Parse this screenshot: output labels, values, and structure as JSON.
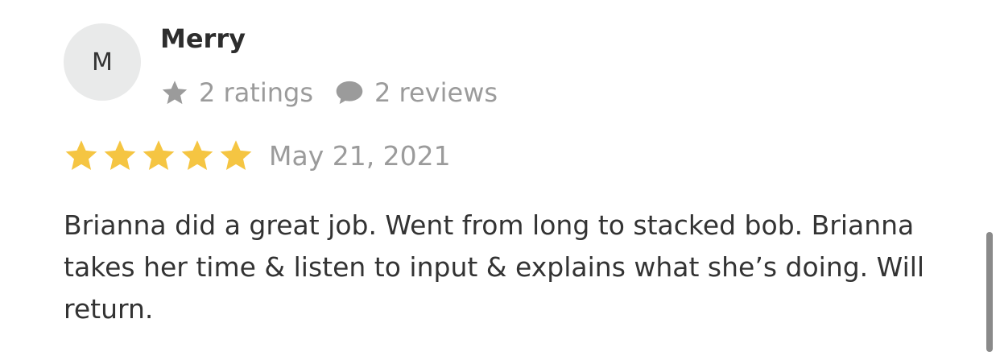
{
  "reviewer": {
    "initial": "M",
    "name": "Merry",
    "ratings_text": "2 ratings",
    "reviews_text": "2 reviews"
  },
  "review": {
    "rating": 5,
    "max_rating": 5,
    "date": "May 21, 2021",
    "text": "Brianna did a great job. Went from long to stacked bob. Brianna takes her time & listen to input & explains what she’s doing. Will return."
  },
  "icons": {
    "meta_rating": "star-icon",
    "meta_reviews": "comment-icon",
    "rating_star": "star-filled-icon"
  },
  "colors": {
    "star": "#f5c542",
    "meta_icon": "#9b9b9b",
    "avatar_bg": "#e9eaea"
  }
}
